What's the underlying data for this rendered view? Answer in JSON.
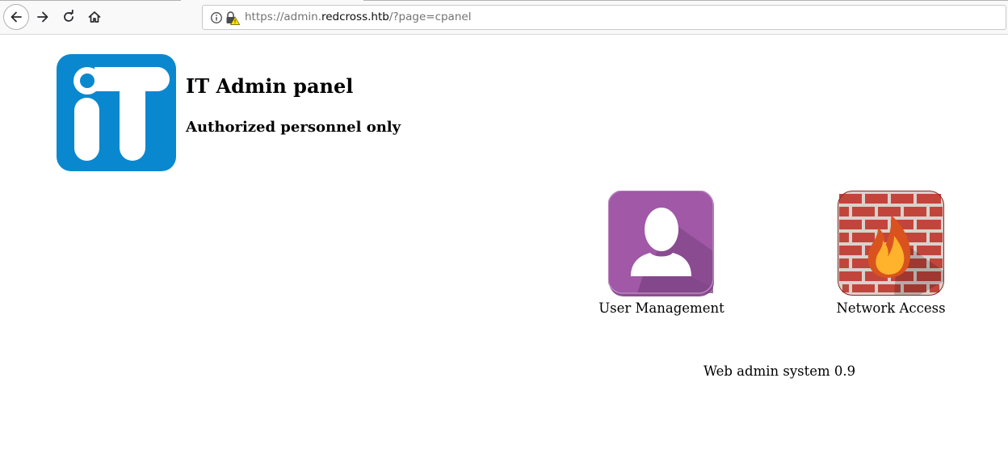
{
  "browser": {
    "url_prefix": "https://admin.",
    "url_host": "redcross.htb",
    "url_suffix": "/?page=cpanel",
    "icons": [
      "back-icon",
      "forward-icon",
      "reload-icon",
      "home-icon",
      "info-icon",
      "insecure-lock-icon"
    ]
  },
  "page": {
    "logo_icon": "it-logo",
    "title": "IT Admin panel",
    "subtitle": "Authorized personnel only",
    "apps": [
      {
        "label": "User Management",
        "icon": "user-icon"
      },
      {
        "label": "Network Access",
        "icon": "firewall-icon"
      }
    ],
    "footer": "Web admin system 0.9"
  },
  "colors": {
    "logo_blue": "#0a88cf",
    "user_purple": "#9d59a3",
    "brick_red": "#b8342c",
    "toolbar_bg": "#f9f9fa"
  }
}
